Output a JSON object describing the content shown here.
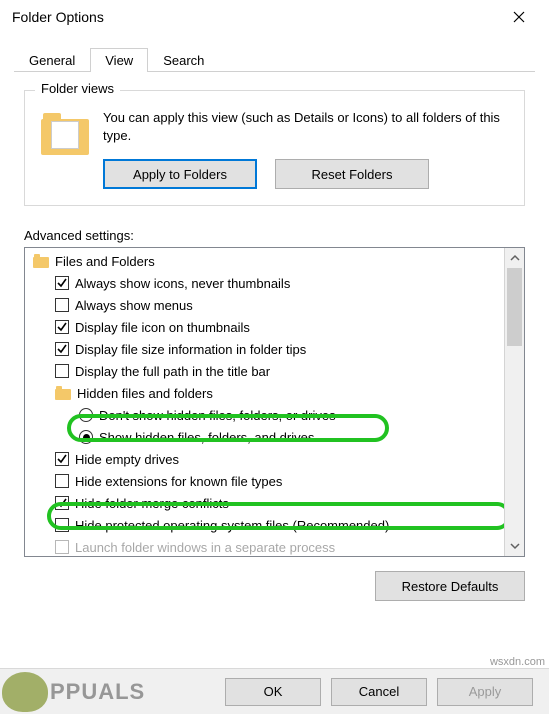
{
  "window": {
    "title": "Folder Options"
  },
  "tabs": {
    "general": "General",
    "view": "View",
    "search": "Search"
  },
  "folderViews": {
    "groupTitle": "Folder views",
    "description": "You can apply this view (such as Details or Icons) to all folders of this type.",
    "applyButton": "Apply to Folders",
    "resetButton": "Reset Folders"
  },
  "advanced": {
    "label": "Advanced settings:",
    "root": "Files and Folders",
    "items": [
      {
        "type": "check",
        "checked": true,
        "label": "Always show icons, never thumbnails"
      },
      {
        "type": "check",
        "checked": false,
        "label": "Always show menus"
      },
      {
        "type": "check",
        "checked": true,
        "label": "Display file icon on thumbnails"
      },
      {
        "type": "check",
        "checked": true,
        "label": "Display file size information in folder tips"
      },
      {
        "type": "check",
        "checked": false,
        "label": "Display the full path in the title bar"
      },
      {
        "type": "folder",
        "label": "Hidden files and folders"
      },
      {
        "type": "radio",
        "checked": false,
        "indent": 2,
        "label": "Don't show hidden files, folders, or drives"
      },
      {
        "type": "radio",
        "checked": true,
        "indent": 2,
        "label": "Show hidden files, folders, and drives"
      },
      {
        "type": "check",
        "checked": true,
        "label": "Hide empty drives"
      },
      {
        "type": "check",
        "checked": false,
        "label": "Hide extensions for known file types"
      },
      {
        "type": "check",
        "checked": true,
        "label": "Hide folder merge conflicts"
      },
      {
        "type": "check",
        "checked": false,
        "label": "Hide protected operating system files (Recommended)"
      },
      {
        "type": "check",
        "checked": false,
        "label": "Launch folder windows in a separate process"
      }
    ],
    "restoreButton": "Restore Defaults"
  },
  "buttons": {
    "ok": "OK",
    "cancel": "Cancel",
    "apply": "Apply"
  },
  "watermark": {
    "brand": "PPUALS",
    "site": "wsxdn.com"
  }
}
